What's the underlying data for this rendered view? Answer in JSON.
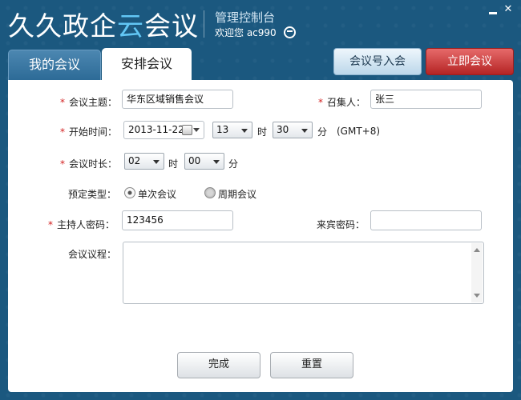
{
  "app": {
    "brand_main": "久久政企",
    "brand_cloud": "云",
    "brand_tail": "会议",
    "console": "管理控制台",
    "welcome": "欢迎您 ac990"
  },
  "window_controls": {
    "minimize_icon": "minimize-icon",
    "close_label": "✕"
  },
  "tabs": [
    {
      "label": "我的会议",
      "active": false
    },
    {
      "label": "安排会议",
      "active": true
    }
  ],
  "header_buttons": {
    "import": "会议号入会",
    "start": "立即会议"
  },
  "form": {
    "required_mark": "*",
    "subject": {
      "label": "会议主题：",
      "value": "华东区域销售会议"
    },
    "convener": {
      "label": "召集人：",
      "value": "张三"
    },
    "start_time": {
      "label": "开始时间：",
      "date": "2013-11-22",
      "hour": "13",
      "hour_unit": "时",
      "minute": "30",
      "minute_unit": "分",
      "timezone": "(GMT+8)"
    },
    "duration": {
      "label": "会议时长：",
      "hours": "02",
      "hours_unit": "时",
      "minutes": "00",
      "minutes_unit": "分"
    },
    "booking_type": {
      "label": "预定类型：",
      "options": [
        "单次会议",
        "周期会议"
      ],
      "selected": "单次会议"
    },
    "host_password": {
      "label": "主持人密码：",
      "value": "123456"
    },
    "guest_password": {
      "label": "来宾密码：",
      "value": ""
    },
    "agenda": {
      "label": "会议议程：",
      "value": ""
    }
  },
  "actions": {
    "done": "完成",
    "reset": "重置"
  },
  "colors": {
    "titlebar": "#1b587f",
    "accent_cloud": "#62c6f4",
    "danger": "#b52424",
    "required": "#d21f1f"
  }
}
